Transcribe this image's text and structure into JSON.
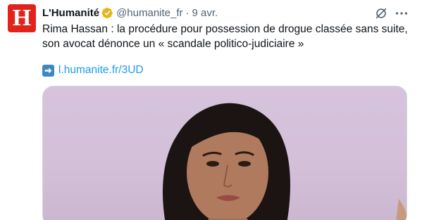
{
  "tweet": {
    "display_name": "L'Humanité",
    "avatar_letter": "H",
    "handle": "@humanite_fr",
    "separator": "·",
    "date": "9 avr.",
    "text_line1": "Rima Hassan : la procédure pour possession de drogue classée sans suite,",
    "text_line2": "son avocat dénonce un « scandale politico-judiciaire »",
    "link_text": "l.humanite.fr/3UD"
  },
  "icons": {
    "verified": "verified-gold-badge-icon",
    "grok": "grok-icon",
    "more": "more-options-icon",
    "link_arrow": "right-arrow-emoji-icon"
  },
  "colors": {
    "avatar_bg": "#e2231a",
    "verified_gold": "#e2b719",
    "link": "#1d9bf0",
    "secondary_text": "#536471",
    "arrow_emoji_bg": "#3b88c3"
  }
}
